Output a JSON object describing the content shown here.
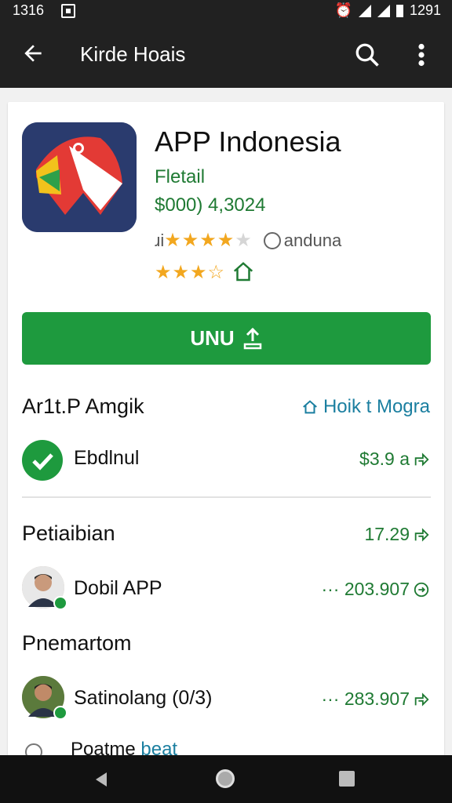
{
  "status": {
    "time": "1316",
    "clock": "1291"
  },
  "appbar": {
    "title": "Kirde Hoais",
    "back_icon": "arrow-left-icon",
    "search_icon": "search-icon",
    "more_icon": "more-vert-icon"
  },
  "app": {
    "name": "APP Indonesia",
    "developer": "Fletail",
    "price": "$000) 4,3024",
    "rating_prefix": "ɹi",
    "rating_stars": 4,
    "rating_label": "anduna",
    "rating2_stars": 3.5,
    "install_label": "UNU"
  },
  "section1": {
    "title": "Ar1t.P Amgik",
    "link": "Hoik t Mogra"
  },
  "row1": {
    "label": "Ebdlnul",
    "value": "$3.9 a"
  },
  "section2": {
    "title": "Petiaibian",
    "value": "17.29"
  },
  "row2": {
    "label": "Dobil APP",
    "value": "··· 203.907"
  },
  "section3": {
    "title": "Pnemartom"
  },
  "row3": {
    "label": "Satinolang (0/3)",
    "value": "··· 283.907"
  },
  "row4": {
    "label_prefix": "Poatme ",
    "label_highlight": "beat"
  },
  "colors": {
    "accent": "#1e9a3e",
    "link": "#1b7fa0",
    "dark_bar": "#212121"
  }
}
